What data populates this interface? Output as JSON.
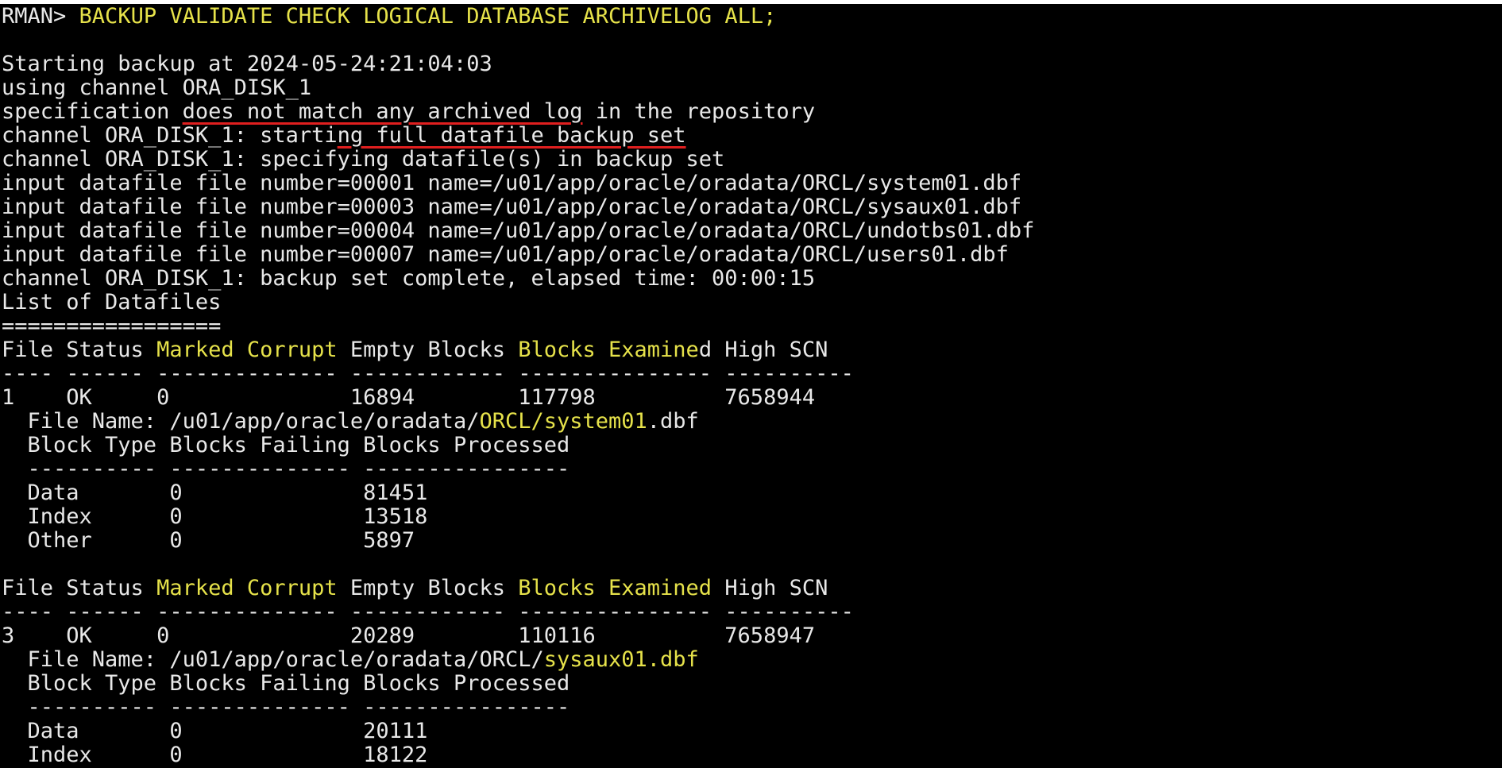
{
  "terminal": {
    "colors": {
      "background": "#000000",
      "text": "#e8e8e8",
      "highlight": "#e6e24a",
      "annotation": "#e01f1f"
    },
    "lines": [
      [
        {
          "t": "RMAN> "
        },
        {
          "t": "BACKUP VALIDATE CHECK LOGICAL DATABASE ARCHIVELOG ALL;",
          "c": "yellow"
        }
      ],
      [],
      [
        {
          "t": "Starting backup at 2024-05-24:21:04:03"
        }
      ],
      [
        {
          "t": "using channel ORA_DISK_1"
        }
      ],
      [
        {
          "t": "specification "
        },
        {
          "t": "does not match any archived log",
          "u": true
        },
        {
          "t": " in the repository"
        }
      ],
      [
        {
          "t": "channel ORA_DISK_1: starti"
        },
        {
          "t": "ng full datafile backup set",
          "u": true
        }
      ],
      [
        {
          "t": "channel ORA_DISK_1: specifying datafile(s) in backup set"
        }
      ],
      [
        {
          "t": "input datafile file number=00001 name=/u01/app/oracle/oradata/ORCL/system01.dbf"
        }
      ],
      [
        {
          "t": "input datafile file number=00003 name=/u01/app/oracle/oradata/ORCL/sysaux01.dbf"
        }
      ],
      [
        {
          "t": "input datafile file number=00004 name=/u01/app/oracle/oradata/ORCL/undotbs01.dbf"
        }
      ],
      [
        {
          "t": "input datafile file number=00007 name=/u01/app/oracle/oradata/ORCL/users01.dbf"
        }
      ],
      [
        {
          "t": "channel ORA_DISK_1: backup set complete, elapsed time: 00:00:15"
        }
      ],
      [
        {
          "t": "List of Datafiles"
        }
      ],
      [
        {
          "t": "================="
        }
      ],
      [
        {
          "t": "File Status "
        },
        {
          "t": "Marked Corrupt",
          "c": "yellow"
        },
        {
          "t": " Empty Blocks "
        },
        {
          "t": "Blocks Examine",
          "c": "yellow"
        },
        {
          "t": "d High SCN"
        }
      ],
      [
        {
          "t": "---- ------ -------------- ------------ --------------- ----------"
        }
      ],
      [
        {
          "t": "1    OK     0              16894        117798          7658944"
        }
      ],
      [
        {
          "t": "  File Name: /u01/app/oracle/oradata/"
        },
        {
          "t": "ORCL/system01",
          "c": "yellow"
        },
        {
          "t": ".dbf"
        }
      ],
      [
        {
          "t": "  Block Type Blocks Failing Blocks Processed"
        }
      ],
      [
        {
          "t": "  ---------- -------------- ----------------"
        }
      ],
      [
        {
          "t": "  Data       0              81451"
        }
      ],
      [
        {
          "t": "  Index      0              13518"
        }
      ],
      [
        {
          "t": "  Other      0              5897"
        }
      ],
      [],
      [
        {
          "t": "File Status "
        },
        {
          "t": "Marked Corrupt",
          "c": "yellow"
        },
        {
          "t": " Empty Blocks "
        },
        {
          "t": "Blocks Examined",
          "c": "yellow"
        },
        {
          "t": " High SCN"
        }
      ],
      [
        {
          "t": "---- ------ -------------- ------------ --------------- ----------"
        }
      ],
      [
        {
          "t": "3    OK     0              20289        110116          7658947"
        }
      ],
      [
        {
          "t": "  File Name: /u01/app/oracle/oradata/ORCL/"
        },
        {
          "t": "sysaux01.dbf",
          "c": "yellow"
        }
      ],
      [
        {
          "t": "  Block Type Blocks Failing Blocks Processed"
        }
      ],
      [
        {
          "t": "  ---------- -------------- ----------------"
        }
      ],
      [
        {
          "t": "  Data       0              20111"
        }
      ],
      [
        {
          "t": "  Index      0              18122"
        }
      ]
    ]
  }
}
